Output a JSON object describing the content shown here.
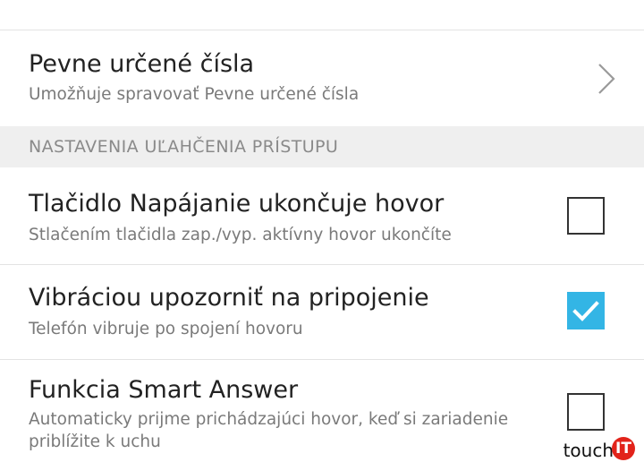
{
  "settings": {
    "fixed_dialing": {
      "title": "Pevne určené čísla",
      "summary": "Umožňuje spravovať Pevne určené čísla"
    },
    "accessibility_section": {
      "header": "NASTAVENIA UĽAHČENIA PRÍSTUPU"
    },
    "power_button_ends_call": {
      "title": "Tlačidlo Napájanie ukončuje hovor",
      "summary": "Stlačením tlačidla zap./vyp. aktívny hovor ukončíte",
      "checked": false
    },
    "vibrate_on_connect": {
      "title": "Vibráciou upozorniť na pripojenie",
      "summary": "Telefón vibruje po spojení hovoru",
      "checked": true
    },
    "smart_answer": {
      "title": "Funkcia Smart Answer",
      "summary_line1": "Automaticky prijme prichádzajúci hovor, keď si zariadenie",
      "summary_line2": "priblížite k uchu",
      "checked": false
    }
  },
  "watermark": {
    "text": "touch",
    "badge": "IT"
  },
  "colors": {
    "accent": "#33b5e5",
    "section_bg": "#efefef",
    "divider": "#e3e3e3",
    "watermark_red": "#e2231a"
  },
  "icons": {
    "chevron": "chevron-right-icon",
    "check": "checkmark-icon"
  }
}
